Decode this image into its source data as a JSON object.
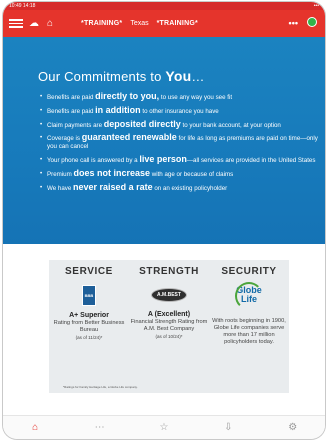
{
  "status_bar": {
    "left": "10:49 14:18",
    "right": "•••"
  },
  "app_bar": {
    "training_left": "*TRAINING*",
    "state": "Texas",
    "training_right": "*TRAINING*",
    "more_label": "•••"
  },
  "hero": {
    "title_prefix": "Our Commitments to ",
    "title_bold": "You",
    "title_suffix": "…",
    "commitments": [
      {
        "pre": "Benefits are paid ",
        "bold": "directly to you,",
        "post": " to use any way you see fit"
      },
      {
        "pre": "Benefits are paid ",
        "bold": "in addition",
        "post": " to other insurance you have"
      },
      {
        "pre": "Claim payments are ",
        "bold": "deposited directly",
        "post": " to your bank account, at your option"
      },
      {
        "pre": "Coverage is ",
        "bold": "guaranteed renewable",
        "post": " for life as long as premiums are paid on time—only you can cancel"
      },
      {
        "pre": "Your phone call is answered by a ",
        "bold": "live person",
        "post": "—all services are provided in the United States"
      },
      {
        "pre": "Premium ",
        "bold": "does not increase",
        "post": " with age or because of claims"
      },
      {
        "pre": "We have ",
        "bold": "never raised a rate",
        "post": " on an existing policyholder"
      }
    ]
  },
  "panel": {
    "service": {
      "heading": "SERVICE",
      "logo_text": "BBB",
      "title": "A+ Superior",
      "sub": "Rating from Better Business Bureau",
      "note": "(as of 11/24)*"
    },
    "strength": {
      "heading": "STRENGTH",
      "logo_text": "A.M.BEST",
      "title": "A (Excellent)",
      "sub": "Financial Strength Rating from A.M. Best Company",
      "note": "(as of 10/24)*"
    },
    "security": {
      "heading": "SECURITY",
      "logo_text_1": "Globe",
      "logo_text_2": "Life",
      "sub": "With roots beginning in 1900, Globe Life companies serve more than 17 million policyholders today."
    },
    "footnote": "*Ratings for Family Heritage Life, a Globe Life company."
  },
  "nav": {
    "items": [
      "home-icon",
      "chat-icon",
      "star-icon",
      "download-icon",
      "settings-icon"
    ]
  },
  "colors": {
    "accent_red": "#e5342c",
    "hero_blue": "#1b83c0",
    "panel_gray": "#e9ecee",
    "online_green": "#32b34a"
  }
}
